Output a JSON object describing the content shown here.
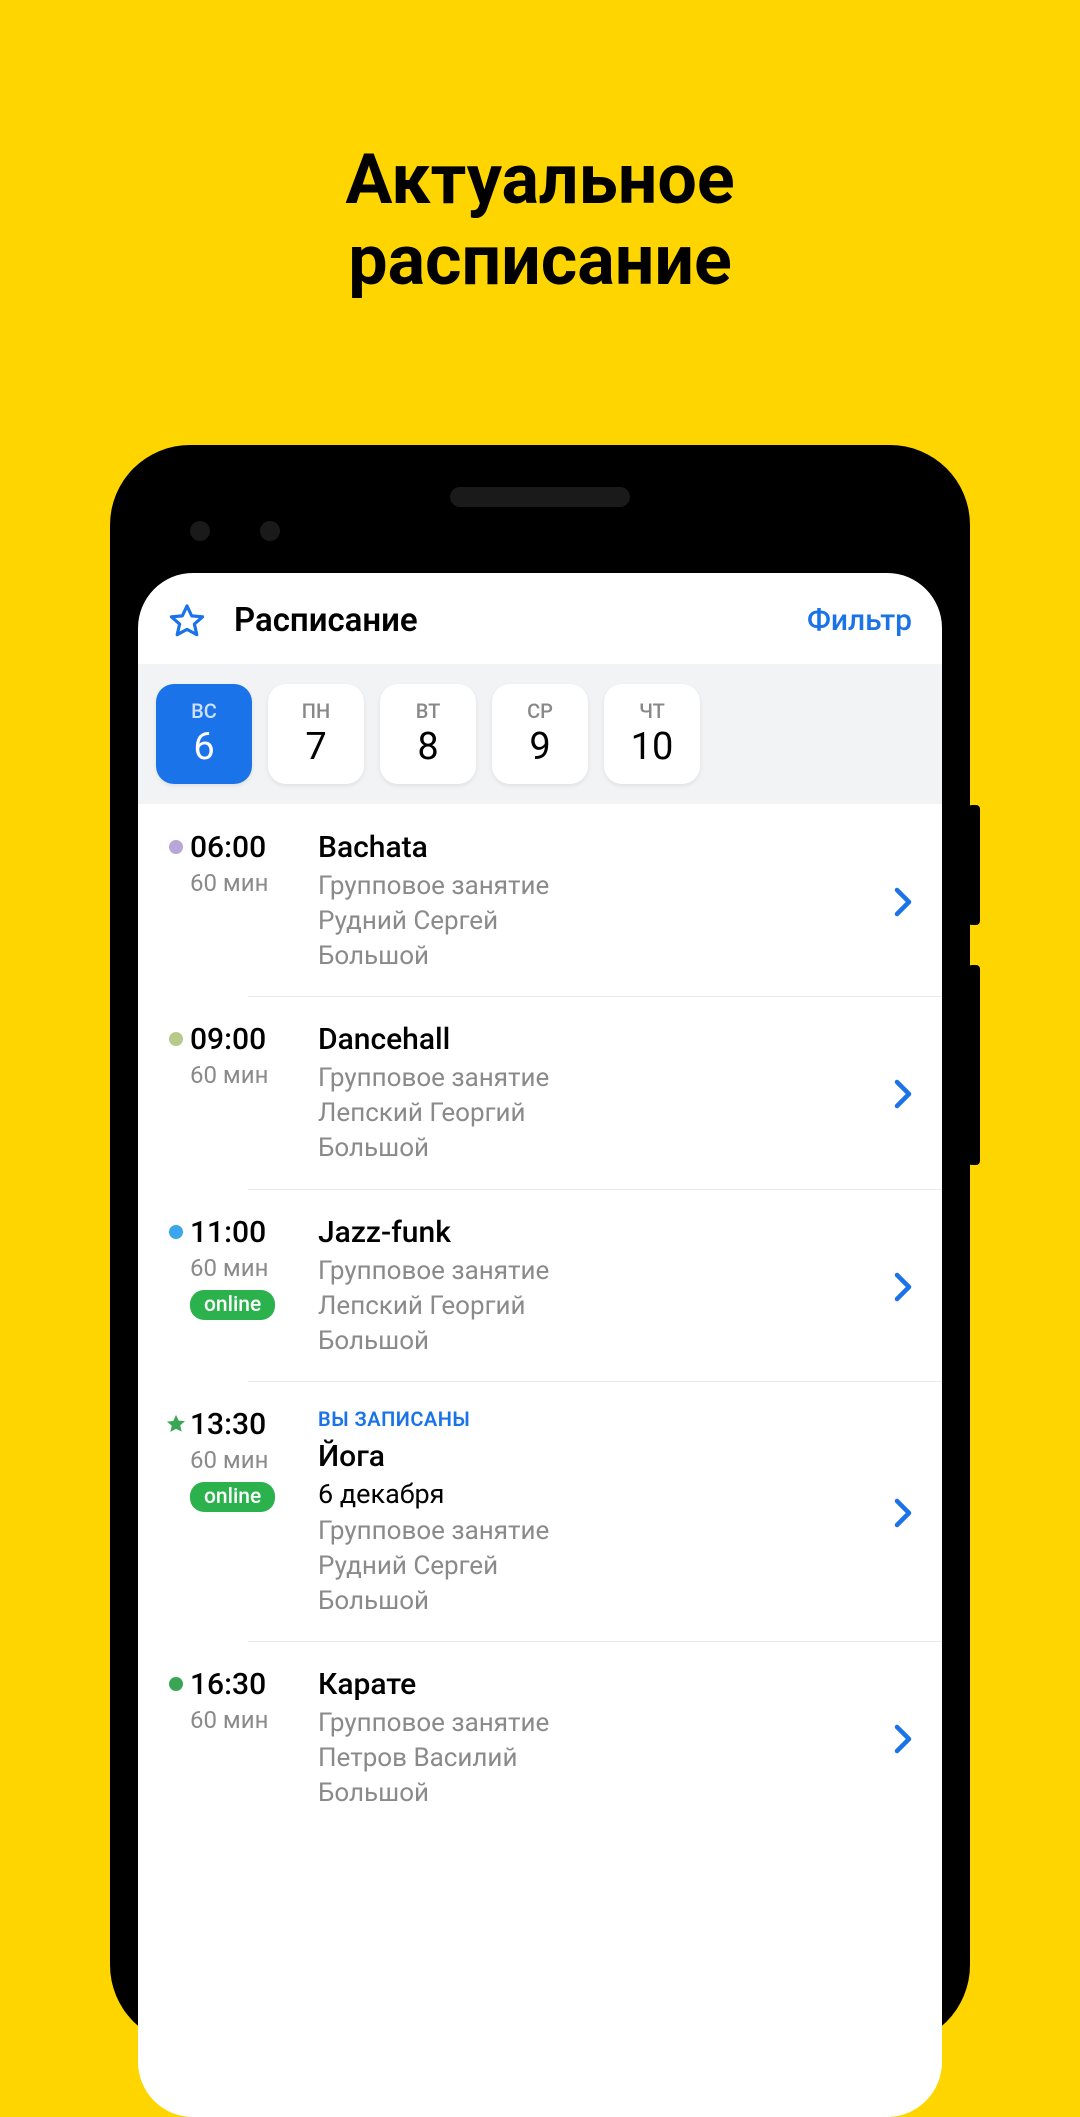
{
  "hero": {
    "line1": "Актуальное",
    "line2": "расписание"
  },
  "header": {
    "title": "Расписание",
    "filter": "Фильтр"
  },
  "days": [
    {
      "dow": "ВС",
      "num": "6",
      "selected": true
    },
    {
      "dow": "ПН",
      "num": "7",
      "selected": false
    },
    {
      "dow": "ВТ",
      "num": "8",
      "selected": false
    },
    {
      "dow": "СР",
      "num": "9",
      "selected": false
    },
    {
      "dow": "ЧТ",
      "num": "10",
      "selected": false
    }
  ],
  "colors": {
    "dot_purple": "#b9a5d6",
    "dot_olive": "#b8c98a",
    "dot_blue": "#3ba6f0",
    "dot_green": "#3aa655",
    "star_green": "#3aa655"
  },
  "events": [
    {
      "marker": "dot",
      "marker_color": "dot_purple",
      "time": "06:00",
      "duration": "60 мин",
      "badge": null,
      "enrolled": null,
      "title": "Bachata",
      "date_line": null,
      "meta": [
        "Групповое занятие",
        "Рудний Сергей",
        "Большой"
      ]
    },
    {
      "marker": "dot",
      "marker_color": "dot_olive",
      "time": "09:00",
      "duration": "60 мин",
      "badge": null,
      "enrolled": null,
      "title": "Dancehall",
      "date_line": null,
      "meta": [
        "Групповое занятие",
        "Лепский Георгий",
        "Большой"
      ]
    },
    {
      "marker": "dot",
      "marker_color": "dot_blue",
      "time": "11:00",
      "duration": "60 мин",
      "badge": "online",
      "enrolled": null,
      "title": "Jazz-funk",
      "date_line": null,
      "meta": [
        "Групповое занятие",
        "Лепский Георгий",
        "Большой"
      ]
    },
    {
      "marker": "star",
      "marker_color": "star_green",
      "time": "13:30",
      "duration": "60 мин",
      "badge": "online",
      "enrolled": "ВЫ ЗАПИСАНЫ",
      "title": "Йога",
      "date_line": "6 декабря",
      "meta": [
        "Групповое занятие",
        "Рудний Сергей",
        "Большой"
      ]
    },
    {
      "marker": "dot",
      "marker_color": "dot_green",
      "time": "16:30",
      "duration": "60 мин",
      "badge": null,
      "enrolled": null,
      "title": "Карате",
      "date_line": null,
      "meta": [
        "Групповое занятие",
        "Петров Василий",
        "Большой"
      ]
    }
  ]
}
